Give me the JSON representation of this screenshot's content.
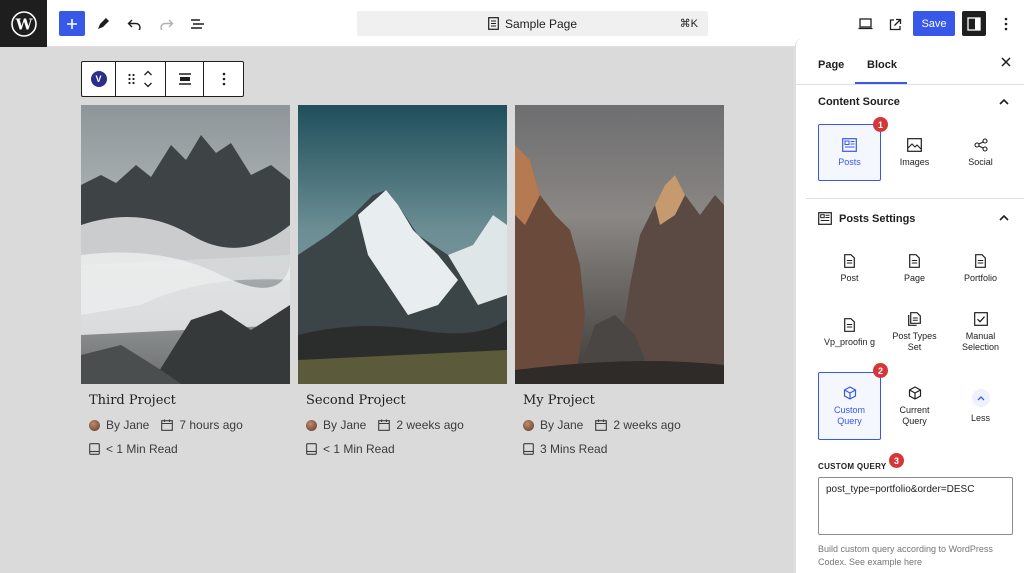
{
  "topbar": {
    "document_title": "Sample Page",
    "shortcut": "⌘K",
    "save_label": "Save"
  },
  "block_toolbar": {
    "badge_letter": "V"
  },
  "cards": [
    {
      "title": "Third Project",
      "author": "By Jane",
      "date": "7 hours ago",
      "read_time": "< 1 Min Read"
    },
    {
      "title": "Second Project",
      "author": "By Jane",
      "date": "2 weeks ago",
      "read_time": "< 1 Min Read"
    },
    {
      "title": "My Project",
      "author": "By Jane",
      "date": "2 weeks ago",
      "read_time": "3 Mins Read"
    }
  ],
  "panel": {
    "tabs": [
      "Page",
      "Block"
    ],
    "active_tab": "Block",
    "content_source": {
      "heading": "Content Source",
      "options": [
        "Posts",
        "Images",
        "Social"
      ],
      "selected": "Posts",
      "badge": "1"
    },
    "posts_settings": {
      "heading": "Posts Settings",
      "options": [
        "Post",
        "Page",
        "Portfolio",
        "Vp_proofin g",
        "Post Types Set",
        "Manual Selection",
        "Custom Query",
        "Current Query",
        "Less"
      ],
      "selected": "Custom Query",
      "badge": "2"
    },
    "custom_query": {
      "label": "CUSTOM QUERY",
      "badge": "3",
      "value": "post_type=portfolio&order=DESC",
      "help": "Build custom query according to WordPress Codex. See example here"
    }
  },
  "colors": {
    "accent": "#3858e9",
    "badge": "#d63638",
    "dark": "#1e1e1e"
  },
  "icons": [
    "wordpress-logo-icon",
    "plus-icon",
    "pen-icon",
    "undo-icon",
    "redo-icon",
    "list-view-icon",
    "document-icon",
    "desktop-preview-icon",
    "external-link-icon",
    "settings-sidebar-icon",
    "more-vertical-icon",
    "close-icon",
    "chevron-up-icon"
  ]
}
